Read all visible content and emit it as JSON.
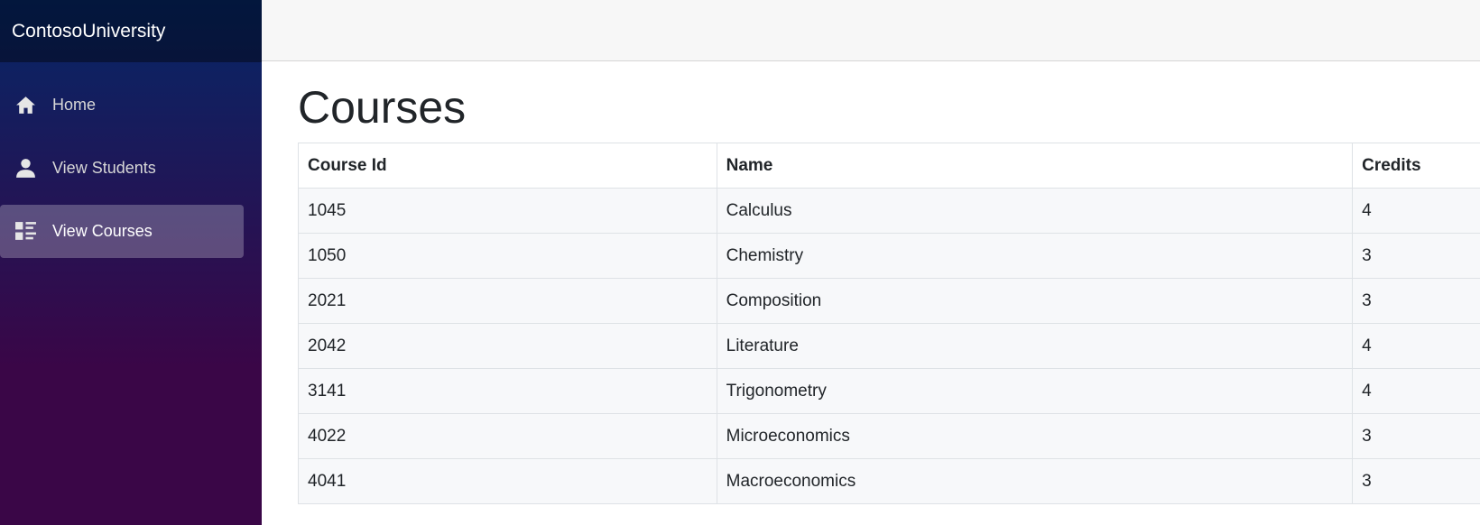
{
  "brand": "ContosoUniversity",
  "nav": {
    "items": [
      {
        "label": "Home",
        "icon": "home-icon",
        "active": false
      },
      {
        "label": "View Students",
        "icon": "person-icon",
        "active": false
      },
      {
        "label": "View Courses",
        "icon": "list-rich-icon",
        "active": true
      }
    ]
  },
  "page": {
    "title": "Courses"
  },
  "table": {
    "headers": [
      "Course Id",
      "Name",
      "Credits"
    ],
    "rows": [
      [
        "1045",
        "Calculus",
        "4"
      ],
      [
        "1050",
        "Chemistry",
        "3"
      ],
      [
        "2021",
        "Composition",
        "3"
      ],
      [
        "2042",
        "Literature",
        "4"
      ],
      [
        "3141",
        "Trigonometry",
        "4"
      ],
      [
        "4022",
        "Microeconomics",
        "3"
      ],
      [
        "4041",
        "Macroeconomics",
        "3"
      ]
    ]
  },
  "colors": {
    "sidebar_gradient_top": "#052767",
    "sidebar_gradient_bottom": "#3a0647",
    "active_nav_bg": "rgba(255,255,255,0.25)",
    "top_row_bg": "#f7f7f7"
  }
}
